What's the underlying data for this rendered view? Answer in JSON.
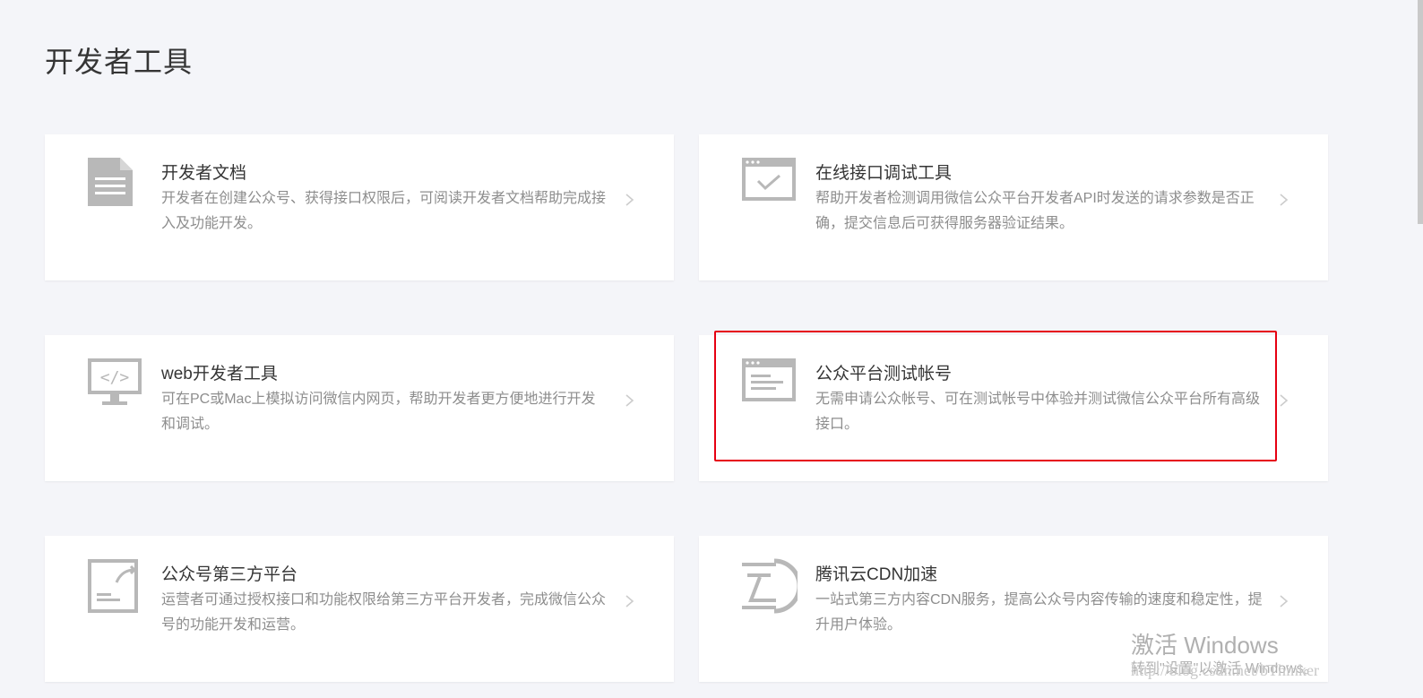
{
  "page": {
    "title": "开发者工具"
  },
  "cards": [
    {
      "title": "开发者文档",
      "desc": "开发者在创建公众号、获得接口权限后，可阅读开发者文档帮助完成接入及功能开发。",
      "icon": "document-icon"
    },
    {
      "title": "在线接口调试工具",
      "desc": "帮助开发者检测调用微信公众平台开发者API时发送的请求参数是否正确，提交信息后可获得服务器验证结果。",
      "icon": "browser-check-icon"
    },
    {
      "title": "web开发者工具",
      "desc": "可在PC或Mac上模拟访问微信内网页，帮助开发者更方便地进行开发和调试。",
      "icon": "monitor-code-icon"
    },
    {
      "title": "公众平台测试帐号",
      "desc": "无需申请公众帐号、可在测试帐号中体验并测试微信公众平台所有高级接口。",
      "icon": "browser-window-icon"
    },
    {
      "title": "公众号第三方平台",
      "desc": "运营者可通过授权接口和功能权限给第三方平台开发者，完成微信公众号的功能开发和运营。",
      "icon": "document-share-icon"
    },
    {
      "title": "腾讯云CDN加速",
      "desc": "一站式第三方内容CDN服务，提高公众号内容传输的速度和稳定性，提升用户体验。",
      "icon": "cloud-logo-icon"
    }
  ],
  "watermark": {
    "activation_title": "激活 Windows",
    "activation_sub": "转到\"设置\"以激活 Windows。",
    "url": "http://blog.csdn.net/bThinker"
  },
  "colors": {
    "background": "#f4f5f9",
    "card": "#ffffff",
    "icon": "#b8b8b8",
    "highlight": "#e60012"
  }
}
